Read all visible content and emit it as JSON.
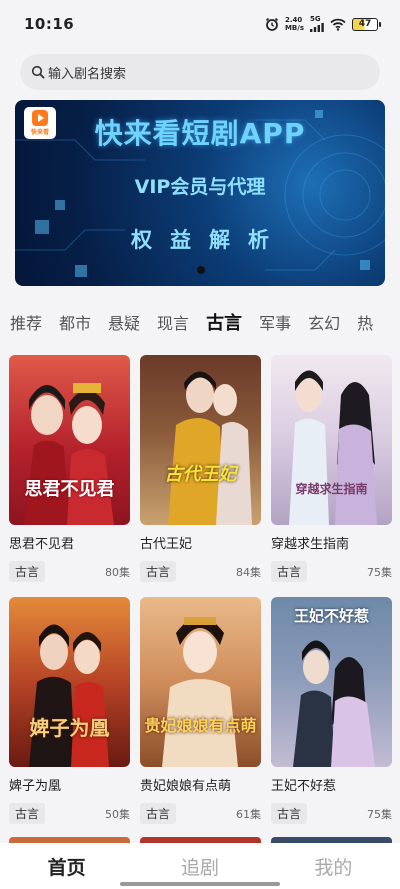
{
  "status_bar": {
    "time": "10:16",
    "net_speed_value": "2.40",
    "net_speed_unit": "MB/s",
    "network_type": "5G",
    "battery": "47"
  },
  "search": {
    "placeholder": "输入剧名搜索"
  },
  "banner": {
    "logo_text": "快来看",
    "title": "快来看短剧APP",
    "subtitle": "VIP会员与代理",
    "tagline": "权益解析"
  },
  "tabs": [
    {
      "label": "推荐",
      "active": false
    },
    {
      "label": "都市",
      "active": false
    },
    {
      "label": "悬疑",
      "active": false
    },
    {
      "label": "现言",
      "active": false
    },
    {
      "label": "古言",
      "active": true
    },
    {
      "label": "军事",
      "active": false
    },
    {
      "label": "玄幻",
      "active": false
    },
    {
      "label": "热",
      "active": false
    }
  ],
  "dramas": [
    {
      "title": "思君不见君",
      "poster_text": "思君不见君",
      "tag": "古言",
      "episodes": "80集",
      "color": "#c8323a"
    },
    {
      "title": "古代王妃",
      "poster_text": "古代王妃",
      "tag": "古言",
      "episodes": "84集",
      "color": "#a86a3a"
    },
    {
      "title": "穿越求生指南",
      "poster_text": "穿越求生指南",
      "tag": "古言",
      "episodes": "75集",
      "color": "#b9a7c9"
    },
    {
      "title": "婢子为凰",
      "poster_text": "婢子为凰",
      "tag": "古言",
      "episodes": "50集",
      "color": "#b2442c"
    },
    {
      "title": "贵妃娘娘有点萌",
      "poster_text": "贵妃娘娘有点萌",
      "tag": "古言",
      "episodes": "61集",
      "color": "#c98a5a"
    },
    {
      "title": "王妃不好惹",
      "poster_text": "王妃不好惹",
      "tag": "古言",
      "episodes": "75集",
      "color": "#6c7a9a"
    }
  ],
  "bottom_nav": [
    {
      "label": "首页",
      "active": true
    },
    {
      "label": "追剧",
      "active": false
    },
    {
      "label": "我的",
      "active": false
    }
  ]
}
